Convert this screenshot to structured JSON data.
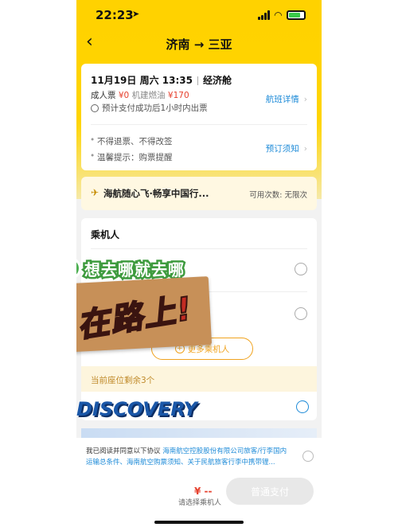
{
  "status": {
    "time": "22:23",
    "location_arrow": "➤"
  },
  "nav": {
    "back": "‹",
    "title": "济南 → 三亚"
  },
  "flight": {
    "date": "11月19日 周六 13:35",
    "cabin": "经济舱",
    "adult_label": "成人票",
    "adult_price": "¥0",
    "tax_label": "机建燃油",
    "tax_price": "¥170",
    "ticket_note": "预计支付成功后1小时内出票",
    "detail_link": "航班详情",
    "rule1": "不得退票、不得改签",
    "rule2": "温馨提示：购票提醒",
    "notice_link": "预订须知"
  },
  "promo": {
    "title": "海航随心飞·畅享中国行...",
    "usage": "可用次数: 无限次"
  },
  "passengers": {
    "heading": "乘机人",
    "more_button": "更多乘机人",
    "seats_left": "当前座位剩余3个"
  },
  "stickers": {
    "top": "想去哪就去哪",
    "main": "在路上!",
    "discovery": "DISCOVERY"
  },
  "agreement": {
    "prefix": "我已阅读并同意以下协议",
    "links": "海南航空控股股份有限公司旅客/行李国内运输总条件、海南航空购票须知、关于民航旅客行李中携带锂..."
  },
  "footer": {
    "price": "¥ --",
    "hint": "请选择乘机人",
    "pay_button": "普通支付"
  },
  "colors": {
    "brand_yellow": "#ffd200",
    "accent_orange": "#f0a31f",
    "link_blue": "#1e8bd8",
    "price_red": "#e6412e"
  }
}
